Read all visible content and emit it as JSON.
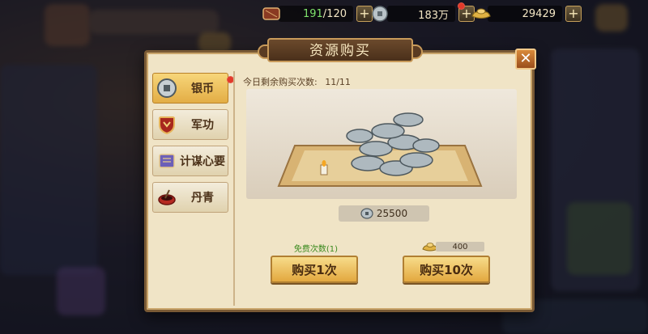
{
  "resources": {
    "stamina": {
      "current": "191",
      "max": "/120",
      "icon": "drum-icon"
    },
    "silver": {
      "value": "183万",
      "icon": "silver-coin-icon"
    },
    "gold": {
      "value": "29429",
      "icon": "gold-ingot-icon"
    },
    "plus_label": "+"
  },
  "dialog": {
    "title": "资源购买",
    "close_label": "✕",
    "remaining_label": "今日剩余购买次数:",
    "remaining_value": "11/11"
  },
  "tabs": [
    {
      "label": "银币",
      "icon": "silver-coin-icon",
      "active": true
    },
    {
      "label": "军功",
      "icon": "shield-badge-icon",
      "active": false
    },
    {
      "label": "计谋心要",
      "icon": "scroll-book-icon",
      "active": false
    },
    {
      "label": "丹青",
      "icon": "ink-bowl-icon",
      "active": false
    }
  ],
  "preview": {
    "amount": "25500"
  },
  "purchase": {
    "free_label": "免费次数(1)",
    "buy_one": "购买1次",
    "buy_ten": "购买10次",
    "ten_cost": "400"
  },
  "colors": {
    "accent": "#e3ad45",
    "panel": "#f0e4c6",
    "frame": "#7a5a35",
    "free_text": "#3b8a1e"
  }
}
